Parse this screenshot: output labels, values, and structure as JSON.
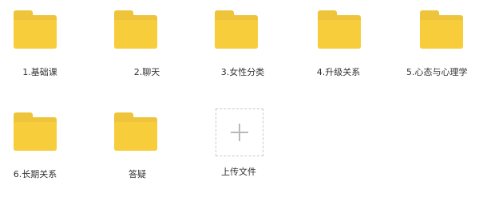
{
  "folders": [
    {
      "label": "1.基础课",
      "icon": "folder-icon"
    },
    {
      "label": "2.聊天",
      "icon": "folder-icon"
    },
    {
      "label": "3.女性分类",
      "icon": "folder-icon"
    },
    {
      "label": "4.升级关系",
      "icon": "folder-icon"
    },
    {
      "label": "5.心态与心理学",
      "icon": "folder-icon"
    },
    {
      "label": "6.长期关系",
      "icon": "folder-icon"
    },
    {
      "label": "答疑",
      "icon": "folder-icon"
    }
  ],
  "upload": {
    "label": "上传文件",
    "icon": "plus-icon"
  },
  "colors": {
    "folder_front": "#f8cd3c",
    "folder_back": "#eec43a",
    "text": "#333333",
    "dashed_border": "#c9c9c9"
  }
}
